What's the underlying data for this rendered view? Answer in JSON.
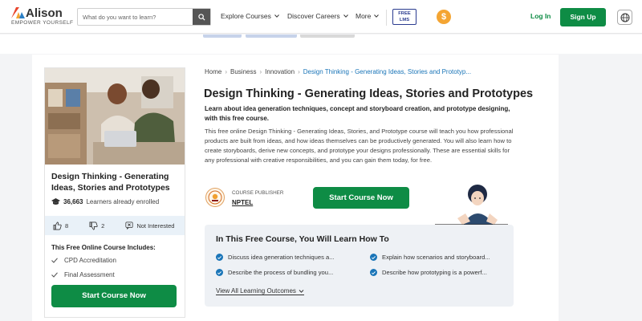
{
  "header": {
    "logo": {
      "name": "Alison",
      "tagline": "EMPOWER YOURSELF"
    },
    "search": {
      "placeholder": "What do you want to learn?"
    },
    "nav": [
      "Explore Courses",
      "Discover Careers",
      "More"
    ],
    "free_lms": {
      "line1": "FREE",
      "line2": "LMS"
    },
    "coin_symbol": "$",
    "login_label": "Log In",
    "signup_label": "Sign Up"
  },
  "course_card": {
    "title": "Design Thinking - Generating Ideas, Stories and Prototypes",
    "learners_count": "36,663",
    "learners_label": "Learners already enrolled",
    "likes": "8",
    "dislikes": "2",
    "not_interested_label": "Not Interested",
    "includes_title": "This Free Online Course Includes:",
    "includes": [
      "CPD Accreditation",
      "Final Assessment"
    ],
    "cta_label": "Start Course Now"
  },
  "breadcrumb": [
    "Home",
    "Business",
    "Innovation",
    "Design Thinking - Generating Ideas, Stories and Prototyp..."
  ],
  "course": {
    "title": "Design Thinking - Generating Ideas, Stories and Prototypes",
    "lead": "Learn about idea generation techniques, concept and storyboard creation, and prototype designing, with this free course.",
    "description": "This free online Design Thinking - Generating Ideas, Stories, and Prototype course will teach you how professional products are built from ideas, and how ideas themselves can be productively generated. You will also learn how to create storyboards, derive new concepts, and prototype your designs professionally. These are essential skills for any professional with creative responsibilities, and you can gain them today, for free.",
    "publisher_label": "COURSE PUBLISHER",
    "publisher_name": "NPTEL",
    "cta_label": "Start Course Now"
  },
  "learn": {
    "title": "In This Free Course, You Will Learn How To",
    "outcomes": [
      "Discuss idea generation techniques a...",
      "Explain how scenarios and storyboard...",
      "Describe the process of bundling you...",
      "Describe how prototyping is a powerf..."
    ],
    "view_all_label": "View All Learning Outcomes"
  },
  "colors": {
    "brand_green": "#0e8c45",
    "link_blue": "#1a75b8",
    "coin_orange": "#f4a533"
  }
}
